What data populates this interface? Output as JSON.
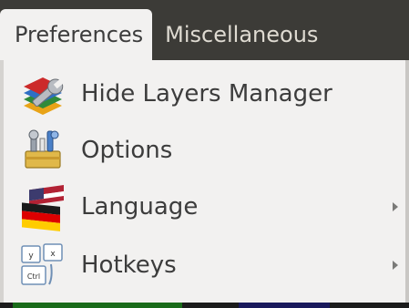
{
  "menubar": {
    "items": [
      {
        "label": "Preferences",
        "state": "open"
      },
      {
        "label": "Miscellaneous",
        "state": "closed"
      }
    ]
  },
  "menu": {
    "items": [
      {
        "label": "Hide Layers Manager",
        "icon": "layers-wrench-icon",
        "has_submenu": false
      },
      {
        "label": "Options",
        "icon": "toolbox-settings-icon",
        "has_submenu": false
      },
      {
        "label": "Language",
        "icon": "flags-language-icon",
        "has_submenu": true
      },
      {
        "label": "Hotkeys",
        "icon": "keyboard-keys-icon",
        "has_submenu": true
      }
    ]
  },
  "colors": {
    "menubar_bg": "#3c3b37",
    "menubar_text": "#dfdbd2",
    "menu_bg": "#f2f1f0",
    "menu_text": "#3c3c3c"
  }
}
